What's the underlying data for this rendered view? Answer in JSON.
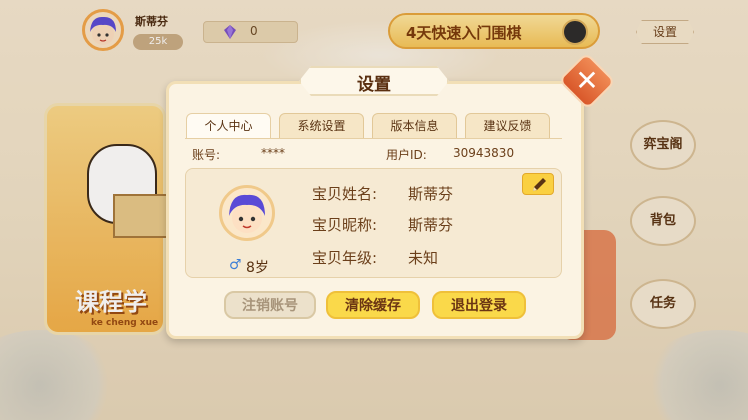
{
  "topbar": {
    "username": "斯蒂芬",
    "coins": "25k",
    "gem_count": "0",
    "course_banner": "4天快速入门围棋",
    "settings_label": "设置"
  },
  "background": {
    "course_card_label": "课程学",
    "course_card_pinyin": "ke cheng xue",
    "side_menu": [
      "弈宝阁",
      "背包",
      "任务"
    ]
  },
  "dialog": {
    "title": "设置",
    "tabs": [
      "个人中心",
      "系统设置",
      "版本信息",
      "建议反馈"
    ],
    "active_tab": "个人中心",
    "account_label": "账号:",
    "account_value": "****",
    "uid_label": "用户ID:",
    "uid_value": "30943830",
    "age": "8岁",
    "gender_icon": "male-icon",
    "fields": [
      {
        "label": "宝贝姓名:",
        "value": "斯蒂芬"
      },
      {
        "label": "宝贝昵称:",
        "value": "斯蒂芬"
      },
      {
        "label": "宝贝年级:",
        "value": "未知"
      }
    ],
    "buttons": {
      "cancel_account": "注销账号",
      "clear_cache": "清除缓存",
      "logout": "退出登录"
    }
  },
  "colors": {
    "accent_yellow": "#fad94a",
    "close_orange": "#e6693a",
    "background": "#f3e6cd"
  }
}
